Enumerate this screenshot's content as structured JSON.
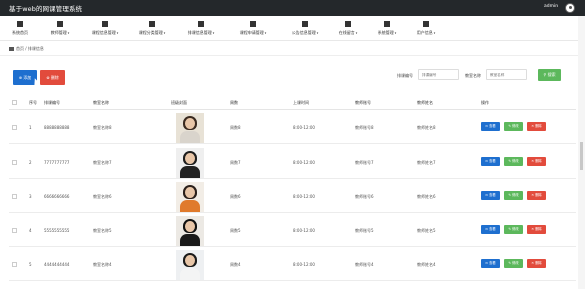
{
  "header": {
    "app_title": "基于web的网课管理系统",
    "user_name": "admin"
  },
  "nav": [
    {
      "label": "系统首页",
      "icon": "home-icon"
    },
    {
      "label": "教师管理",
      "icon": "user-icon",
      "dropdown": true
    },
    {
      "label": "课程信息管理",
      "icon": "chart-icon",
      "dropdown": true
    },
    {
      "label": "课程分类管理",
      "icon": "grid-icon",
      "dropdown": true
    },
    {
      "label": "排课信息管理",
      "icon": "grid-icon",
      "dropdown": true
    },
    {
      "label": "课程申请管理",
      "icon": "grid-icon",
      "dropdown": true
    },
    {
      "label": "公告信息管理",
      "icon": "monitor-icon",
      "dropdown": true
    },
    {
      "label": "在线留言",
      "icon": "flag-icon",
      "dropdown": true
    },
    {
      "label": "系统管理",
      "icon": "grid-icon",
      "dropdown": true
    },
    {
      "label": "用户信息",
      "icon": "calendar-icon",
      "dropdown": true
    }
  ],
  "breadcrumb": {
    "home": "首页",
    "separator": "/",
    "current": "排课信息"
  },
  "toolbar": {
    "add_label": "添加",
    "delete_label": "删除",
    "search_label": "搜索"
  },
  "search": {
    "field1_label": "排课编号",
    "field1_placeholder": "排课编号",
    "field2_label": "教室名称",
    "field2_placeholder": "教室名称"
  },
  "table": {
    "headers": [
      "序号",
      "排课编号",
      "教室名称",
      "班级封面",
      "周数",
      "上课时间",
      "教师账号",
      "教师姓名",
      "操作"
    ],
    "rows": [
      {
        "index": "1",
        "code": "8888888888",
        "room": "教室名称8",
        "week": "周数8",
        "time": "8:00-12:00",
        "account": "教师账号8",
        "name": "教师姓名8",
        "photo_colors": {
          "bg": "#e8e2d6",
          "hair": "#3a2a20",
          "torso": "#d9d4cc"
        }
      },
      {
        "index": "2",
        "code": "7777777777",
        "room": "教室名称7",
        "week": "周数7",
        "time": "8:00-12:00",
        "account": "教师账号7",
        "name": "教师姓名7",
        "photo_colors": {
          "bg": "#efefef",
          "hair": "#1d1d1d",
          "torso": "#222222"
        }
      },
      {
        "index": "3",
        "code": "6666666666",
        "room": "教室名称6",
        "week": "周数6",
        "time": "8:00-12:00",
        "account": "教师账号6",
        "name": "教师姓名6",
        "photo_colors": {
          "bg": "#f2ede6",
          "hair": "#2a1f1a",
          "torso": "#e07a2c"
        }
      },
      {
        "index": "4",
        "code": "5555555555",
        "room": "教室名称5",
        "week": "周数5",
        "time": "8:00-12:00",
        "account": "教师账号5",
        "name": "教师姓名5",
        "photo_colors": {
          "bg": "#ece9e4",
          "hair": "#111111",
          "torso": "#1a1a1a"
        }
      },
      {
        "index": "5",
        "code": "4444444444",
        "room": "教室名称4",
        "week": "周数4",
        "time": "8:00-12:00",
        "account": "教师账号4",
        "name": "教师姓名4",
        "photo_colors": {
          "bg": "#eef0f2",
          "hair": "#1a1a1a",
          "torso": "#f4f4f4"
        }
      }
    ],
    "row_actions": {
      "view": "查看",
      "edit": "修改",
      "delete": "删除"
    }
  },
  "colors": {
    "primary": "#1e6fcf",
    "success": "#5cb85c",
    "danger": "#e24b3c",
    "topbar": "#24282b"
  }
}
